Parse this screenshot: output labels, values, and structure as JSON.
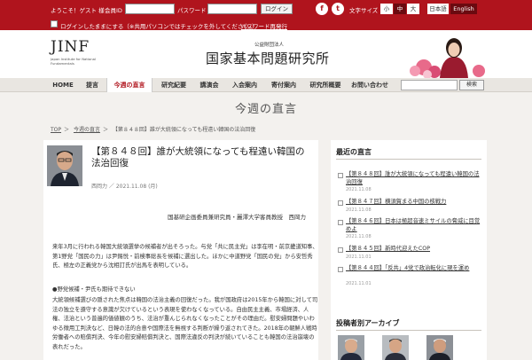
{
  "topbar": {
    "greeting": "ようこそ！ゲスト 様",
    "member_id_label": "会員ID",
    "password_label": "パスワード",
    "login_button": "ログイン",
    "facebook_glyph": "f",
    "twitter_glyph": "t",
    "font_size_label": "文字サイズ",
    "font_sizes": [
      "小",
      "中",
      "大"
    ],
    "lang_ja": "日本語",
    "lang_en": "English",
    "keep_login": "ログインしたままにする（※共用パソコンではチェックを外してください。）",
    "forgot_password": "パスワード再発行"
  },
  "header": {
    "logo": "JINF",
    "logo_sub": "Japan Institute for National Fundamentals",
    "site_prefix": "公益財団法人",
    "site_title": "国家基本問題研究所"
  },
  "nav": {
    "items": [
      "HOME",
      "提言",
      "今週の直言",
      "研究紀要",
      "講演会",
      "入会案内",
      "寄付案内",
      "研究所概要",
      "お問い合わせ"
    ],
    "search_button": "検索"
  },
  "page": {
    "heading": "今週の直言",
    "breadcrumb": [
      "TOP",
      "今週の直言",
      "【第８４８回】誰が大統領になっても程遠い韓国の法治回復"
    ]
  },
  "article": {
    "title": "【第８４８回】誰が大統領になっても程遠い韓国の法治回復",
    "author_date": "西岡力 ／ 2021.11.08 (月)",
    "affiliation": "国基研企画委員兼研究員・麗澤大学客員教授　西岡力",
    "paragraph1": "来年3月に行われる韓国大統領選挙の候補者が出そろった。与党「共に民主党」は李在明・前京畿道知事、第1野党「国民の力」は尹錫悦・前検事総長を候補に選出した。ほかに中道野党「国民の党」から安哲秀氏、極左の正義党から沈相訂氏が出馬を表明している。",
    "subheading": "●野党候補・尹氏も期待できない",
    "paragraph2": "大統領候補選びの隠された焦点は韓国の法治主義の回復だった。我が国政府は2015年から韓国に対して司法の独立を遵守する意識が欠けているという表現を使わなくなっている。自由民主主義、市場経済、人権、法治という普遍的価値観のうち、法治が重んじられなくなったことがその理由だ。慰安婦問題やいわゆる徴用工判決など、日韓の法的合意や国際法を無視する判断が繰り返されてきた。2018年の朝鮮人戦時労働者への賠償判決、今年の慰安婦賠償判決と、国際法違反の判決が続いていることも韓国の法治崩壊の表れだった。"
  },
  "sidebar": {
    "recent_heading": "最近の直言",
    "recent": [
      {
        "title": "【第８４８回】誰が大統領になっても程遠い韓国の法治回復",
        "date": "2021.11.08"
      },
      {
        "title": "【第８４７回】横須賀まる中国の核戦力",
        "date": "2021.11.08"
      },
      {
        "title": "【第８４６回】日本は極超音速ミサイルの脅威に目覚めよ",
        "date": "2021.11.08"
      },
      {
        "title": "【第８４５回】新時代迎えたCOP",
        "date": "2021.11.01"
      },
      {
        "title": "【第８４４回】「反共」4党で政治転化に現を運め",
        "date": "2021.11.01"
      }
    ],
    "archive_heading": "投稿者別アーカイブ"
  },
  "colors": {
    "brand_red": "#b0141d",
    "dark_red": "#6b0a10",
    "background": "#f3f1ee"
  }
}
